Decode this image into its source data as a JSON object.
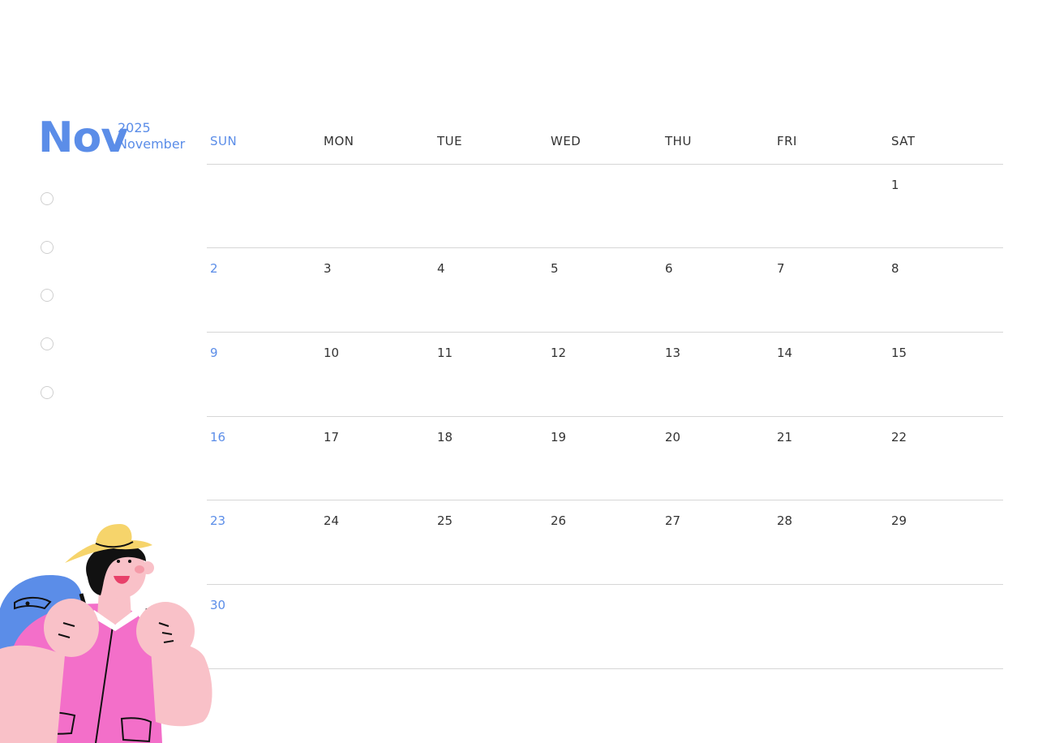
{
  "header": {
    "month_abbr": "Nov",
    "year": "2025",
    "month_full": "November"
  },
  "checklist_count": 5,
  "weekdays": [
    "SUN",
    "MON",
    "TUE",
    "WED",
    "THU",
    "FRI",
    "SAT"
  ],
  "weeks": [
    [
      "",
      "",
      "",
      "",
      "",
      "",
      "1"
    ],
    [
      "2",
      "3",
      "4",
      "5",
      "6",
      "7",
      "8"
    ],
    [
      "9",
      "10",
      "11",
      "12",
      "13",
      "14",
      "15"
    ],
    [
      "16",
      "17",
      "18",
      "19",
      "20",
      "21",
      "22"
    ],
    [
      "23",
      "24",
      "25",
      "26",
      "27",
      "28",
      "29"
    ],
    [
      "30",
      "",
      "",
      "",
      "",
      "",
      ""
    ]
  ],
  "colors": {
    "accent": "#5b8de8",
    "text": "#333333",
    "grid": "#d6d6d6"
  }
}
